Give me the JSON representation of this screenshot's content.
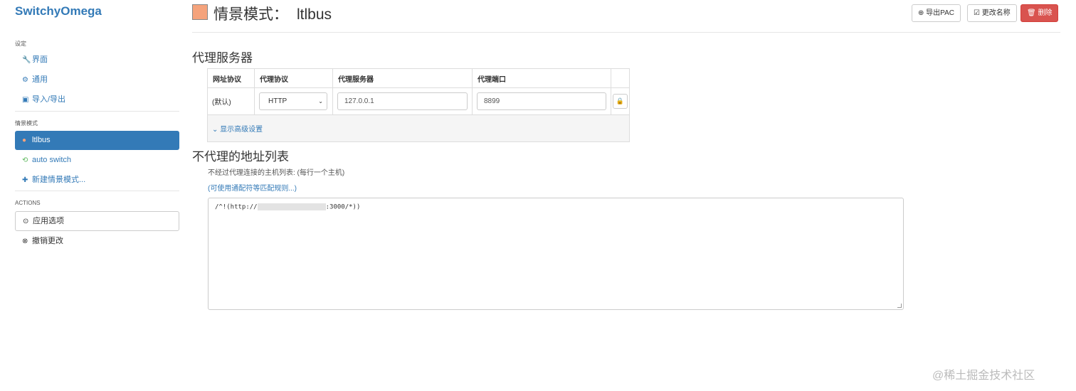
{
  "sidebar": {
    "brand": "SwitchyOmega",
    "sections": {
      "settings": "设定",
      "profiles": "情景模式",
      "actions": "ACTIONS"
    },
    "settings_items": [
      {
        "label": "界面",
        "icon": "wrench-icon"
      },
      {
        "label": "通用",
        "icon": "gear-icon"
      },
      {
        "label": "导入/导出",
        "icon": "floppy-icon"
      }
    ],
    "profile_items": [
      {
        "label": "ltlbus",
        "icon": "globe-icon",
        "active": true
      },
      {
        "label": "auto switch",
        "icon": "retweet-icon"
      },
      {
        "label": "新建情景模式...",
        "icon": "plus-icon"
      }
    ],
    "action_items": [
      {
        "label": "应用选项",
        "icon": "check-circle-icon"
      },
      {
        "label": "撤销更改",
        "icon": "remove-circle-icon"
      }
    ]
  },
  "header": {
    "title": "情景模式：",
    "profile_name": "ltlbus",
    "color": "#f5a37c",
    "buttons": {
      "export_pac": "导出PAC",
      "rename": "更改名称",
      "delete": "删除"
    }
  },
  "proxy_section": {
    "heading": "代理服务器",
    "columns": [
      "网址协议",
      "代理协议",
      "代理服务器",
      "代理端口"
    ],
    "row": {
      "scheme": "(默认)",
      "protocol": "HTTP",
      "server": "127.0.0.1",
      "port": "8899"
    },
    "advanced_link": "显示高级设置"
  },
  "bypass_section": {
    "heading": "不代理的地址列表",
    "description": "不经过代理连接的主机列表: (每行一个主机)",
    "wildcard_link": "(可使用通配符等匹配规则...)",
    "rule_prefix": "/^!(http://",
    "rule_suffix": ":3000/*))"
  },
  "watermark": "@稀土掘金技术社区"
}
